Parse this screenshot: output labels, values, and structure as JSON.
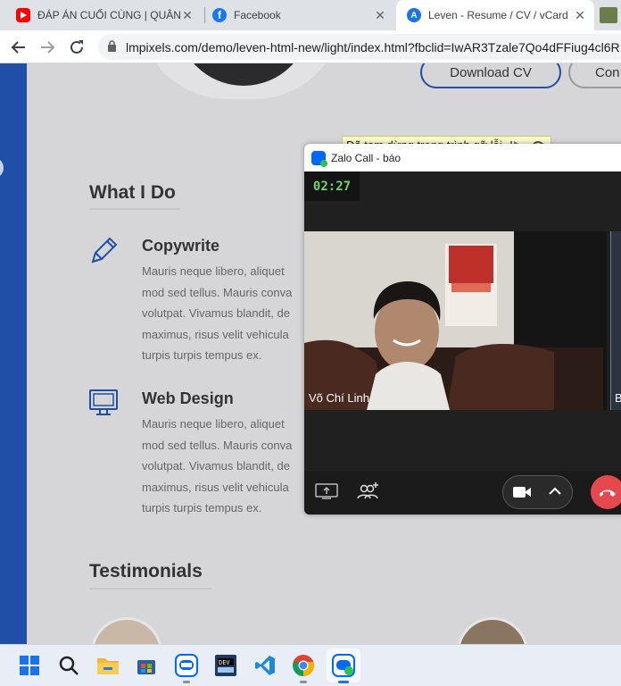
{
  "browser": {
    "tabs": [
      {
        "title": "ĐÁP ÁN CUỐI CÙNG | QUÂN",
        "favicon": "youtube-icon",
        "color": "#ff0000"
      },
      {
        "title": "Facebook",
        "favicon": "facebook-icon",
        "color": "#1877f2"
      },
      {
        "title": "Leven - Resume / CV / vCard",
        "favicon": "leven-icon",
        "color": "#1a73e8"
      }
    ],
    "url": "lmpixels.com/demo/leven-html-new/light/index.html?fbclid=IwAR3Tzale7Qo4dFFiug4cl6R"
  },
  "page": {
    "download_cv": "Download CV",
    "contact": "Con",
    "debug_paused": "Đã tạm dừng trong trình gỡ lỗi",
    "what_i_do_title": "What I Do",
    "services": [
      {
        "title": "Copywrite",
        "icon": "pencil-icon",
        "lines": [
          "Mauris neque libero, aliquet",
          "mod sed tellus. Mauris conva",
          "volutpat. Vivamus blandit, de",
          "maximus, risus velit vehicula",
          "turpis turpis tempus ex."
        ]
      },
      {
        "title": "Web Design",
        "icon": "monitor-icon",
        "lines": [
          "Mauris neque libero, aliquet",
          "mod sed tellus. Mauris conva",
          "volutpat. Vivamus blandit, de",
          "maximus, risus velit vehicula",
          "turpis turpis tempus ex."
        ]
      }
    ],
    "testimonials_title": "Testimonials",
    "accent": "#1f4fa6"
  },
  "call": {
    "window_title": "Zalo Call - báo",
    "timer": "02:27",
    "callee_name": "Võ Chí Linh",
    "side_label": "B"
  },
  "taskbar": {
    "icons": [
      "windows-start-icon",
      "search-icon",
      "file-explorer-icon",
      "microsoft-store-icon",
      "zalo-icon",
      "dev-icon",
      "vscode-icon",
      "chrome-icon",
      "zalo-call-icon"
    ]
  }
}
